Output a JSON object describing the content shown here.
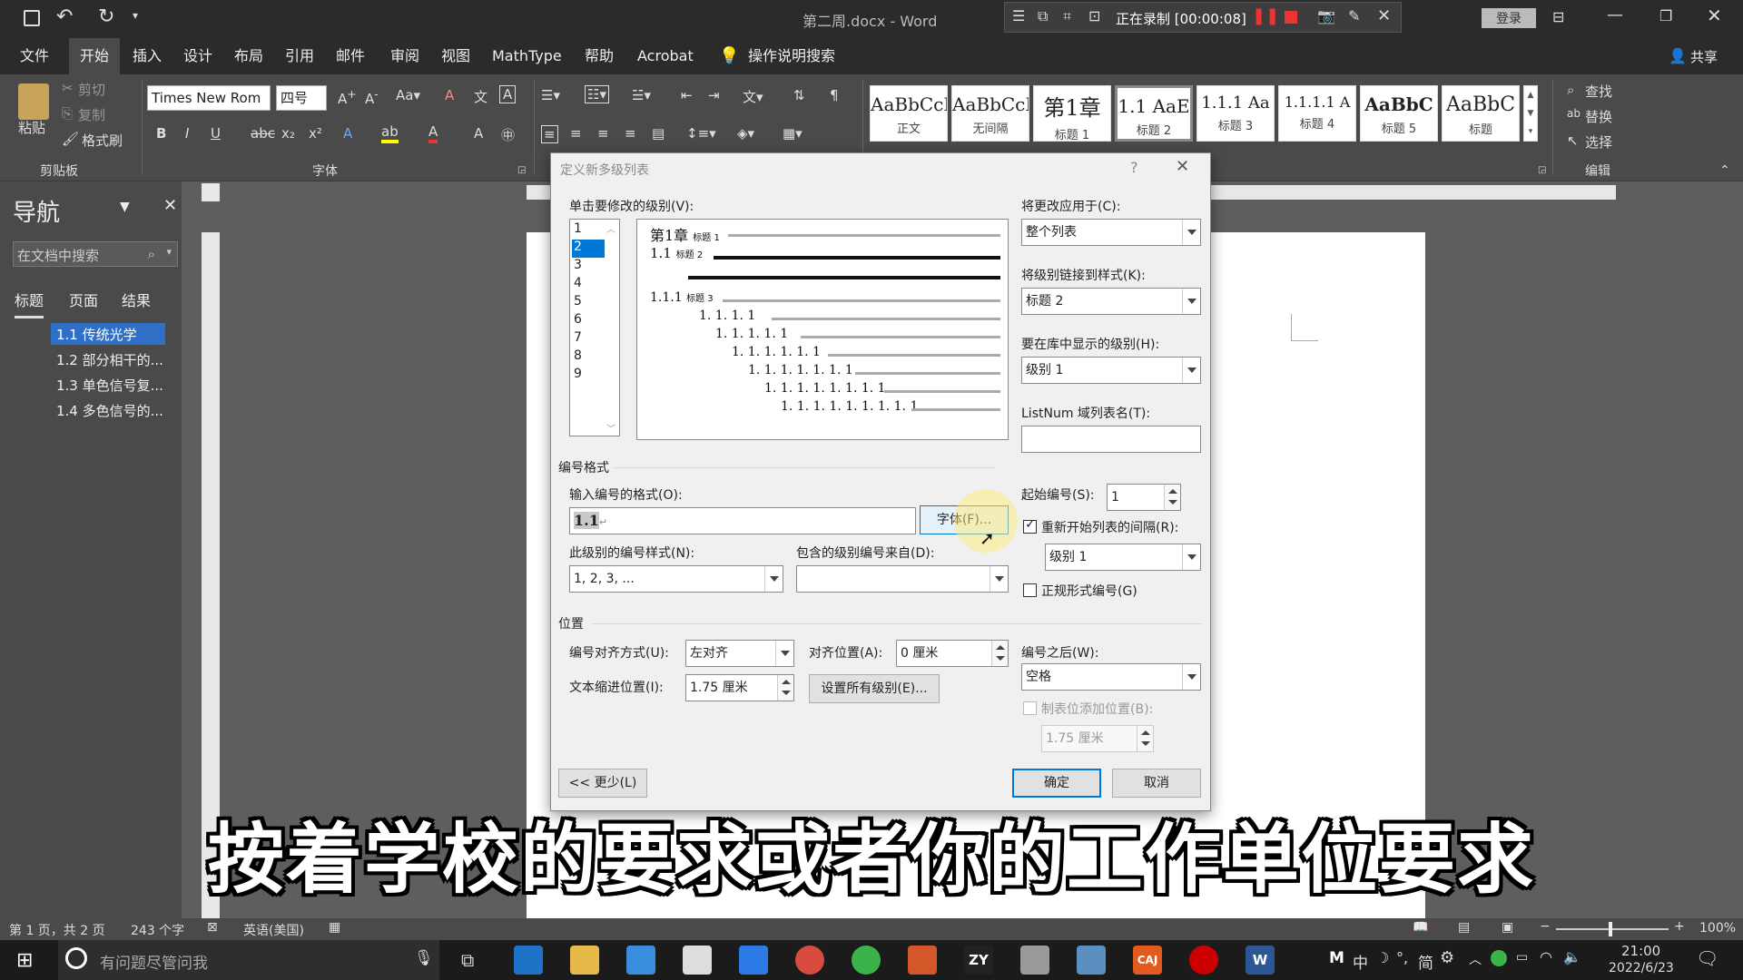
{
  "window": {
    "title": "第二周.docx - Word",
    "login": "登录"
  },
  "recording": {
    "status": "正在录制 [00:00:08]"
  },
  "tabs": [
    "文件",
    "开始",
    "插入",
    "设计",
    "布局",
    "引用",
    "邮件",
    "审阅",
    "视图",
    "MathType",
    "帮助",
    "Acrobat",
    "操作说明搜索"
  ],
  "share": "共享",
  "clipboard": {
    "paste": "粘贴",
    "cut": "剪切",
    "copy": "复制",
    "format_painter": "格式刷",
    "group": "剪贴板"
  },
  "font": {
    "name": "Times New Rom",
    "size": "四号",
    "group": "字体"
  },
  "styles": [
    {
      "preview": "AaBbCcI",
      "name": "正文"
    },
    {
      "preview": "AaBbCcI",
      "name": "无间隔"
    },
    {
      "preview": "第1章",
      "name": "标题 1"
    },
    {
      "preview": "1.1 AaE",
      "name": "标题 2"
    },
    {
      "preview": "1.1.1 Aa",
      "name": "标题 3"
    },
    {
      "preview": "1.1.1.1 A",
      "name": "标题 4"
    },
    {
      "preview": "AaBbC",
      "name": "标题 5"
    },
    {
      "preview": "AaBbC",
      "name": "标题"
    }
  ],
  "editing": {
    "find": "查找",
    "replace": "替换",
    "select": "选择",
    "group": "编辑"
  },
  "nav": {
    "title": "导航",
    "search_placeholder": "在文档中搜索",
    "tabs": [
      "标题",
      "页面",
      "结果"
    ],
    "items": [
      "1.1 传统光学",
      "1.2 部分相干的...",
      "1.3 单色信号复...",
      "1.4 多色信号的..."
    ]
  },
  "dialog": {
    "title": "定义新多级列表",
    "help": "?",
    "level_label": "单击要修改的级别(V):",
    "levels": [
      "1",
      "2",
      "3",
      "4",
      "5",
      "6",
      "7",
      "8",
      "9"
    ],
    "preview": [
      {
        "num": "第1章",
        "tag": "标题 1"
      },
      {
        "num": "1.1",
        "tag": "标题 2"
      },
      {
        "num": "1.1.1",
        "tag": "标题 3"
      },
      {
        "num": "1. 1. 1. 1",
        "tag": ""
      },
      {
        "num": "1. 1. 1. 1. 1",
        "tag": ""
      },
      {
        "num": "1. 1. 1. 1. 1. 1",
        "tag": ""
      },
      {
        "num": "1. 1. 1. 1. 1. 1. 1",
        "tag": ""
      },
      {
        "num": "1. 1. 1. 1. 1. 1. 1. 1",
        "tag": ""
      },
      {
        "num": "1. 1. 1. 1. 1. 1. 1. 1. 1",
        "tag": ""
      }
    ],
    "apply_to_label": "将更改应用于(C):",
    "apply_to_value": "整个列表",
    "link_style_label": "将级别链接到样式(K):",
    "link_style_value": "标题 2",
    "gallery_level_label": "要在库中显示的级别(H):",
    "gallery_level_value": "级别 1",
    "listnum_label": "ListNum 域列表名(T):",
    "listnum_value": "",
    "format_section": "编号格式",
    "enter_format_label": "输入编号的格式(O):",
    "enter_format_value": "1.1",
    "font_button": "字体(F)...",
    "number_style_label": "此级别的编号样式(N):",
    "number_style_value": "1, 2, 3, ...",
    "include_from_label": "包含的级别编号来自(D):",
    "include_from_value": "",
    "start_at_label": "起始编号(S):",
    "start_at_value": "1",
    "restart_label": "重新开始列表的间隔(R):",
    "restart_value": "级别 1",
    "legal_label": "正规形式编号(G)",
    "position_section": "位置",
    "alignment_label": "编号对齐方式(U):",
    "alignment_value": "左对齐",
    "aligned_at_label": "对齐位置(A):",
    "aligned_at_value": "0 厘米",
    "indent_label": "文本缩进位置(I):",
    "indent_value": "1.75 厘米",
    "set_all_button": "设置所有级别(E)...",
    "follow_label": "编号之后(W):",
    "follow_value": "空格",
    "tab_stop_label": "制表位添加位置(B):",
    "tab_stop_value": "1.75 厘米",
    "less_button": "<< 更少(L)",
    "ok_button": "确定",
    "cancel_button": "取消"
  },
  "status": {
    "page": "第 1 页，共 2 页",
    "words": "243 个字",
    "lang": "英语(美国)",
    "zoom": "100%"
  },
  "taskbar": {
    "search": "有问题尽管问我",
    "ime": "中",
    "ime2": "简",
    "time": "21:00",
    "date": "2022/6/23"
  },
  "subtitle": "按着学校的要求或者你的工作单位要求"
}
